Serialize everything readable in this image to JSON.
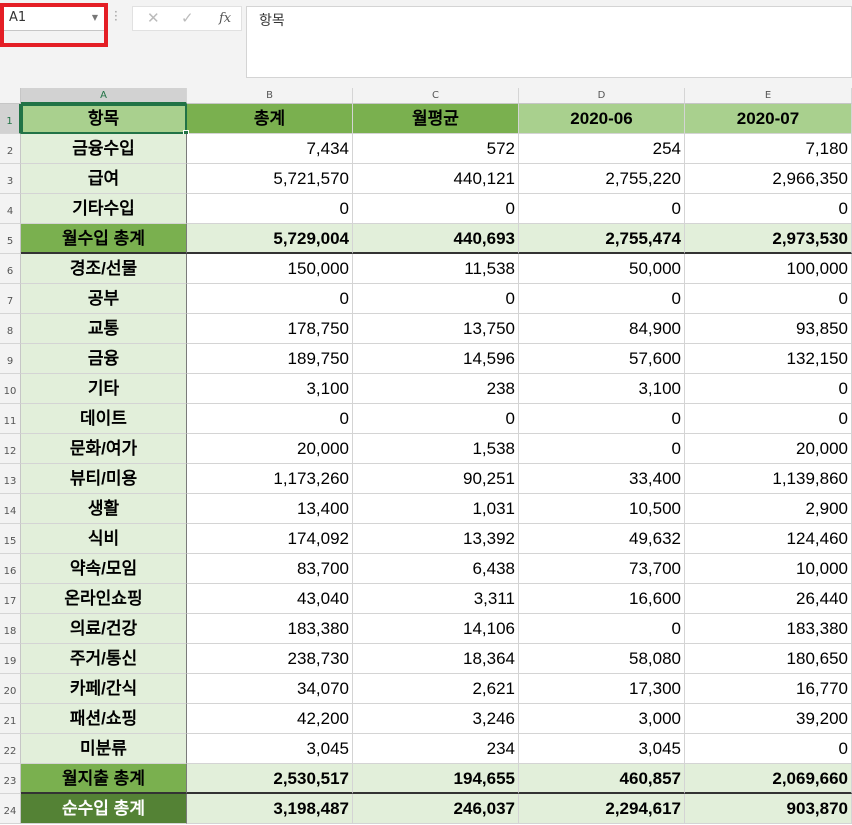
{
  "namebox": {
    "value": "A1"
  },
  "formula_bar": {
    "cancel_icon": "close-icon",
    "enter_icon": "check-icon",
    "fx_label": "fx",
    "content": "항목"
  },
  "columns": [
    "A",
    "B",
    "C",
    "D",
    "E"
  ],
  "header": [
    "항목",
    "총계",
    "월평균",
    "2020-06",
    "2020-07"
  ],
  "rows": [
    {
      "num": "2",
      "label": "금융수입",
      "vals": [
        "7,434",
        "572",
        "254",
        "7,180"
      ],
      "kind": "income"
    },
    {
      "num": "3",
      "label": "급여",
      "vals": [
        "5,721,570",
        "440,121",
        "2,755,220",
        "2,966,350"
      ],
      "kind": "income"
    },
    {
      "num": "4",
      "label": "기타수입",
      "vals": [
        "0",
        "0",
        "0",
        "0"
      ],
      "kind": "income"
    },
    {
      "num": "5",
      "label": "월수입 총계",
      "vals": [
        "5,729,004",
        "440,693",
        "2,755,474",
        "2,973,530"
      ],
      "kind": "sum"
    },
    {
      "num": "6",
      "label": "경조/선물",
      "vals": [
        "150,000",
        "11,538",
        "50,000",
        "100,000"
      ],
      "kind": "expense"
    },
    {
      "num": "7",
      "label": "공부",
      "vals": [
        "0",
        "0",
        "0",
        "0"
      ],
      "kind": "expense"
    },
    {
      "num": "8",
      "label": "교통",
      "vals": [
        "178,750",
        "13,750",
        "84,900",
        "93,850"
      ],
      "kind": "expense"
    },
    {
      "num": "9",
      "label": "금융",
      "vals": [
        "189,750",
        "14,596",
        "57,600",
        "132,150"
      ],
      "kind": "expense"
    },
    {
      "num": "10",
      "label": "기타",
      "vals": [
        "3,100",
        "238",
        "3,100",
        "0"
      ],
      "kind": "expense"
    },
    {
      "num": "11",
      "label": "데이트",
      "vals": [
        "0",
        "0",
        "0",
        "0"
      ],
      "kind": "expense"
    },
    {
      "num": "12",
      "label": "문화/여가",
      "vals": [
        "20,000",
        "1,538",
        "0",
        "20,000"
      ],
      "kind": "expense"
    },
    {
      "num": "13",
      "label": "뷰티/미용",
      "vals": [
        "1,173,260",
        "90,251",
        "33,400",
        "1,139,860"
      ],
      "kind": "expense"
    },
    {
      "num": "14",
      "label": "생활",
      "vals": [
        "13,400",
        "1,031",
        "10,500",
        "2,900"
      ],
      "kind": "expense"
    },
    {
      "num": "15",
      "label": "식비",
      "vals": [
        "174,092",
        "13,392",
        "49,632",
        "124,460"
      ],
      "kind": "expense"
    },
    {
      "num": "16",
      "label": "약속/모임",
      "vals": [
        "83,700",
        "6,438",
        "73,700",
        "10,000"
      ],
      "kind": "expense"
    },
    {
      "num": "17",
      "label": "온라인쇼핑",
      "vals": [
        "43,040",
        "3,311",
        "16,600",
        "26,440"
      ],
      "kind": "expense"
    },
    {
      "num": "18",
      "label": "의료/건강",
      "vals": [
        "183,380",
        "14,106",
        "0",
        "183,380"
      ],
      "kind": "expense"
    },
    {
      "num": "19",
      "label": "주거/통신",
      "vals": [
        "238,730",
        "18,364",
        "58,080",
        "180,650"
      ],
      "kind": "expense"
    },
    {
      "num": "20",
      "label": "카페/간식",
      "vals": [
        "34,070",
        "2,621",
        "17,300",
        "16,770"
      ],
      "kind": "expense"
    },
    {
      "num": "21",
      "label": "패션/쇼핑",
      "vals": [
        "42,200",
        "3,246",
        "3,000",
        "39,200"
      ],
      "kind": "expense"
    },
    {
      "num": "22",
      "label": "미분류",
      "vals": [
        "3,045",
        "234",
        "3,045",
        "0"
      ],
      "kind": "expense"
    },
    {
      "num": "23",
      "label": "월지출 총계",
      "vals": [
        "2,530,517",
        "194,655",
        "460,857",
        "2,069,660"
      ],
      "kind": "sum"
    },
    {
      "num": "24",
      "label": "순수입 총계",
      "vals": [
        "3,198,487",
        "246,037",
        "2,294,617",
        "903,870"
      ],
      "kind": "net"
    }
  ],
  "colors": {
    "accent": "#217346",
    "highlight": "#e41e25",
    "header_green": "#7ab04f",
    "light_green": "#e2efda",
    "net_green": "#548235"
  }
}
